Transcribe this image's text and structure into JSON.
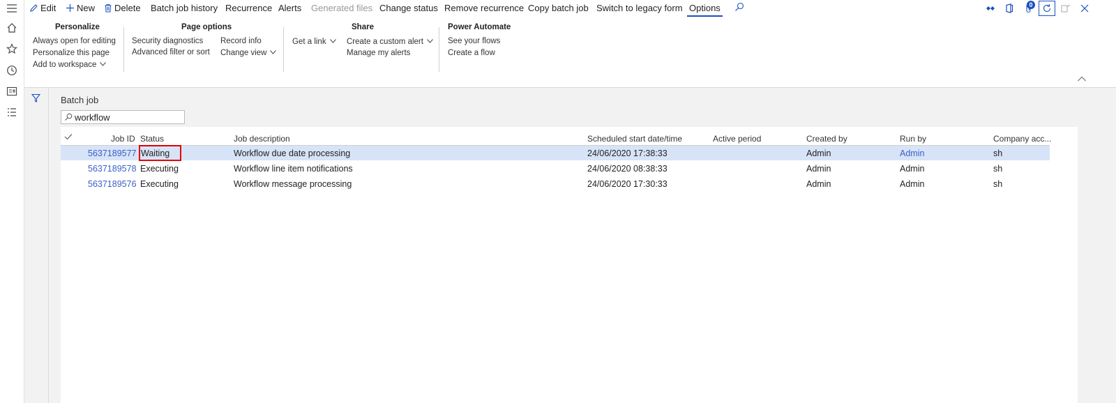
{
  "toolbar": {
    "edit": "Edit",
    "new": "New",
    "delete": "Delete",
    "batch_job_history": "Batch job history",
    "recurrence": "Recurrence",
    "alerts": "Alerts",
    "generated_files": "Generated files",
    "change_status": "Change status",
    "remove_recurrence": "Remove recurrence",
    "copy_batch_job": "Copy batch job",
    "switch_legacy": "Switch to legacy form",
    "options": "Options",
    "notification_count": "0"
  },
  "action_pane": {
    "personalize": {
      "title": "Personalize",
      "always_open": "Always open for editing",
      "personalize_page": "Personalize this page",
      "add_workspace": "Add to workspace"
    },
    "page_options": {
      "title": "Page options",
      "security_diag": "Security diagnostics",
      "adv_filter": "Advanced filter or sort",
      "record_info": "Record info",
      "change_view": "Change view"
    },
    "share": {
      "title": "Share",
      "get_link": "Get a link",
      "custom_alert": "Create a custom alert",
      "manage_alerts": "Manage my alerts"
    },
    "power_automate": {
      "title": "Power Automate",
      "see_flows": "See your flows",
      "create_flow": "Create a flow"
    }
  },
  "page": {
    "title": "Batch job",
    "search_value": "workflow"
  },
  "grid": {
    "columns": {
      "job_id": "Job ID",
      "status": "Status",
      "job_description": "Job description",
      "scheduled_start": "Scheduled start date/time",
      "active_period": "Active period",
      "created_by": "Created by",
      "run_by": "Run by",
      "company": "Company acc..."
    },
    "rows": [
      {
        "job_id": "5637189577",
        "status": "Waiting",
        "description": "Workflow due date processing",
        "scheduled": "24/06/2020 17:38:33",
        "active_period": "",
        "created_by": "Admin",
        "run_by": "Admin",
        "company": "sh"
      },
      {
        "job_id": "5637189578",
        "status": "Executing",
        "description": "Workflow line item notifications",
        "scheduled": "24/06/2020 08:38:33",
        "active_period": "",
        "created_by": "Admin",
        "run_by": "Admin",
        "company": "sh"
      },
      {
        "job_id": "5637189576",
        "status": "Executing",
        "description": "Workflow message processing",
        "scheduled": "24/06/2020 17:30:33",
        "active_period": "",
        "created_by": "Admin",
        "run_by": "Admin",
        "company": "sh"
      }
    ]
  },
  "colors": {
    "accent": "#1a4fbf",
    "link": "#3a5fc8",
    "selected_row": "#d7e3f7",
    "highlight": "#e60000"
  }
}
